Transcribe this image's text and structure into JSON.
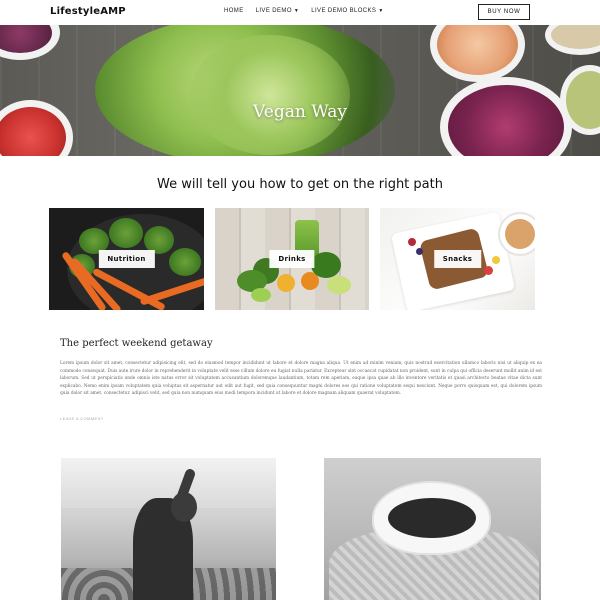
{
  "nav": {
    "logo": "LifestyleAMP",
    "items": [
      {
        "label": "HOME",
        "dropdown": false
      },
      {
        "label": "LIVE DEMO",
        "dropdown": true
      },
      {
        "label": "LIVE DEMO BLOCKS",
        "dropdown": true
      }
    ],
    "cta": "BUY NOW"
  },
  "hero": {
    "title": "Vegan Way"
  },
  "section": {
    "heading": "We will tell you how to get on the right path"
  },
  "cards": [
    {
      "label": "Nutrition"
    },
    {
      "label": "Drinks"
    },
    {
      "label": "Snacks"
    }
  ],
  "article": {
    "title": "The perfect weekend getaway",
    "body": "Lorem ipsum dolor sit amet, consectetur adipisicing elit, sed do eiusmod tempor incididunt ut labore et dolore magna aliqua. Ut enim ad minim veniam, quis nostrud exercitation ullamco laboris nisi ut aliquip ex ea commodo consequat. Duis aute irure dolor in reprehenderit in voluptate velit esse cillum dolore eu fugiat nulla pariatur. Excepteur sint occaecat cupidatat non proident, sunt in culpa qui officia deserunt mollit anim id est laborum. Sed ut perspiciatis unde omnis iste natus error sit voluptatem accusantium doloremque laudantium, totam rem aperiam, eaque ipsa quae ab illo inventore veritatis et quasi architecto beatae vitae dicta sunt explicabo. Nemo enim ipsam voluptatem quia voluptas sit aspernatur aut odit aut fugit, sed quia consequuntur magni dolores eos qui ratione voluptatem sequi nesciunt. Neque porro quisquam est, qui dolorem ipsum quia dolor sit amet, consectetur, adipisci velit, sed quia non numquam eius modi tempora incidunt ut labore et dolore magnam aliquam quaerat voluptatem.",
    "comment_link": "LEAVE A COMMENT"
  },
  "colors": {
    "text": "#222222",
    "muted": "#666666",
    "white": "#ffffff"
  }
}
